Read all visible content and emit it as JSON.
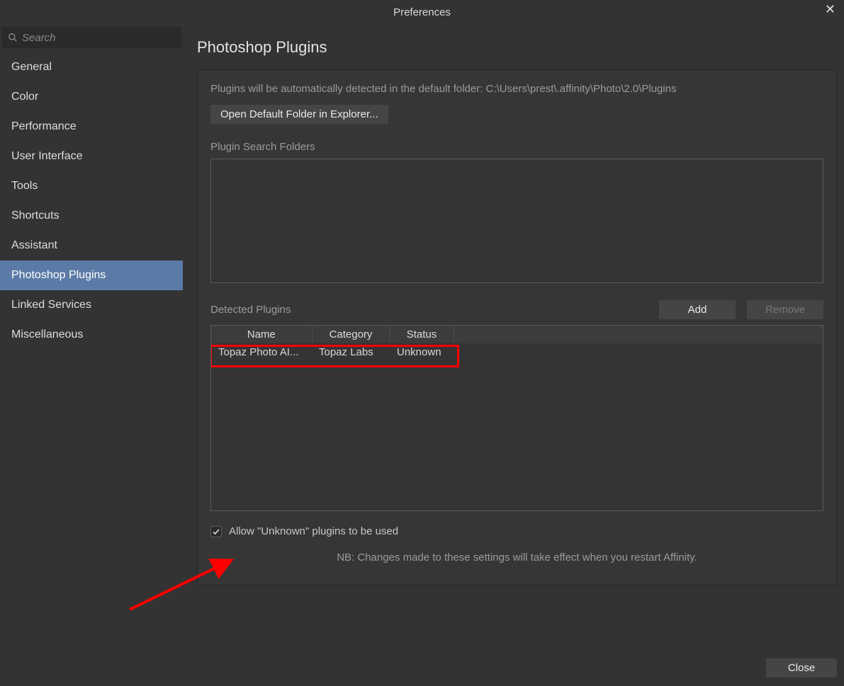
{
  "window": {
    "title": "Preferences"
  },
  "search": {
    "placeholder": "Search"
  },
  "sidebar": {
    "items": [
      {
        "label": "General"
      },
      {
        "label": "Color"
      },
      {
        "label": "Performance"
      },
      {
        "label": "User Interface"
      },
      {
        "label": "Tools"
      },
      {
        "label": "Shortcuts"
      },
      {
        "label": "Assistant"
      },
      {
        "label": "Photoshop Plugins",
        "selected": true
      },
      {
        "label": "Linked Services"
      },
      {
        "label": "Miscellaneous"
      }
    ]
  },
  "main": {
    "page_title": "Photoshop Plugins",
    "info_line": "Plugins will be automatically detected in the default folder: C:\\Users\\prest\\.affinity\\Photo\\2.0\\Plugins",
    "open_folder_btn": "Open Default Folder in Explorer...",
    "search_folders_label": "Plugin Search Folders",
    "detected_label": "Detected Plugins",
    "add_btn": "Add",
    "remove_btn": "Remove",
    "table": {
      "headers": {
        "name": "Name",
        "category": "Category",
        "status": "Status"
      },
      "rows": [
        {
          "name": "Topaz Photo AI...",
          "category": "Topaz Labs",
          "status": "Unknown"
        }
      ]
    },
    "allow_unknown_label": "Allow \"Unknown\" plugins to be used",
    "allow_unknown_checked": true,
    "note": "NB: Changes made to these settings will take effect when you restart Affinity.",
    "close_btn": "Close"
  }
}
